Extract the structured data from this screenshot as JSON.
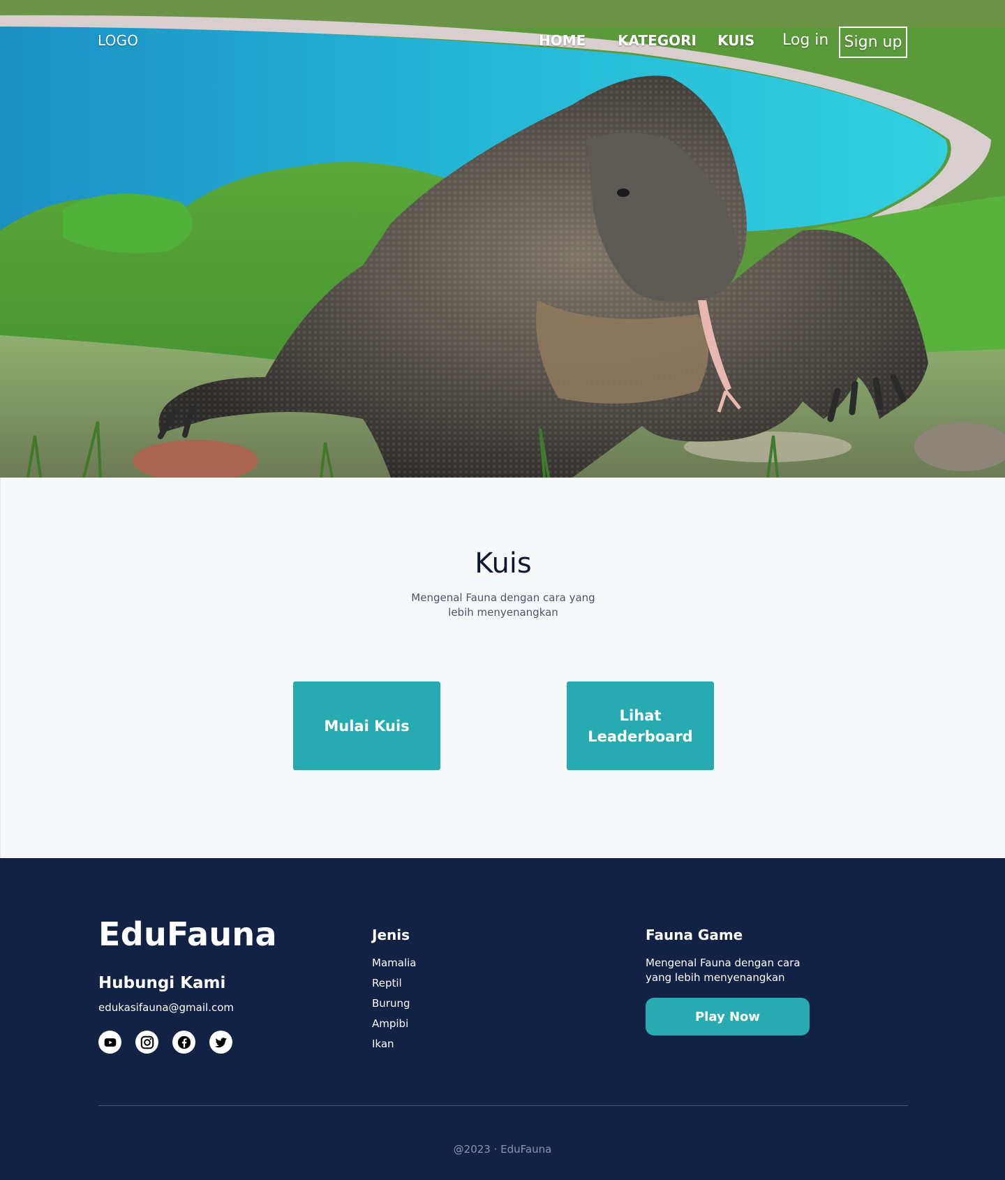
{
  "nav": {
    "logo": "LOGO",
    "links": [
      "HOME",
      "KATEGORI",
      "KUIS"
    ],
    "login_label": "Log in",
    "signup_label": "Sign up"
  },
  "kuis": {
    "title": "Kuis",
    "subtitle": "Mengenal Fauna dengan cara yang lebih menyenangkan",
    "start_button": "Mulai Kuis",
    "leaderboard_button": "Lihat Leaderboard"
  },
  "footer": {
    "brand": "EduFauna",
    "contact_heading": "Hubungi Kami",
    "contact_email": "edukasifauna@gmail.com",
    "social_icons": [
      "youtube-icon",
      "instagram-icon",
      "facebook-icon",
      "twitter-icon"
    ],
    "jenis_heading": "Jenis",
    "jenis_items": [
      "Mamalia",
      "Reptil",
      "Burung",
      "Ampibi",
      "Ikan"
    ],
    "game_heading": "Fauna Game",
    "game_description": "Mengenal Fauna dengan cara yang lebih menyenangkan",
    "play_button": "Play Now",
    "copyright": "@2023 · EduFauna"
  },
  "colors": {
    "accent_teal": "#27abb1",
    "footer_navy": "#122244",
    "section_background": "#f6f8fa"
  }
}
